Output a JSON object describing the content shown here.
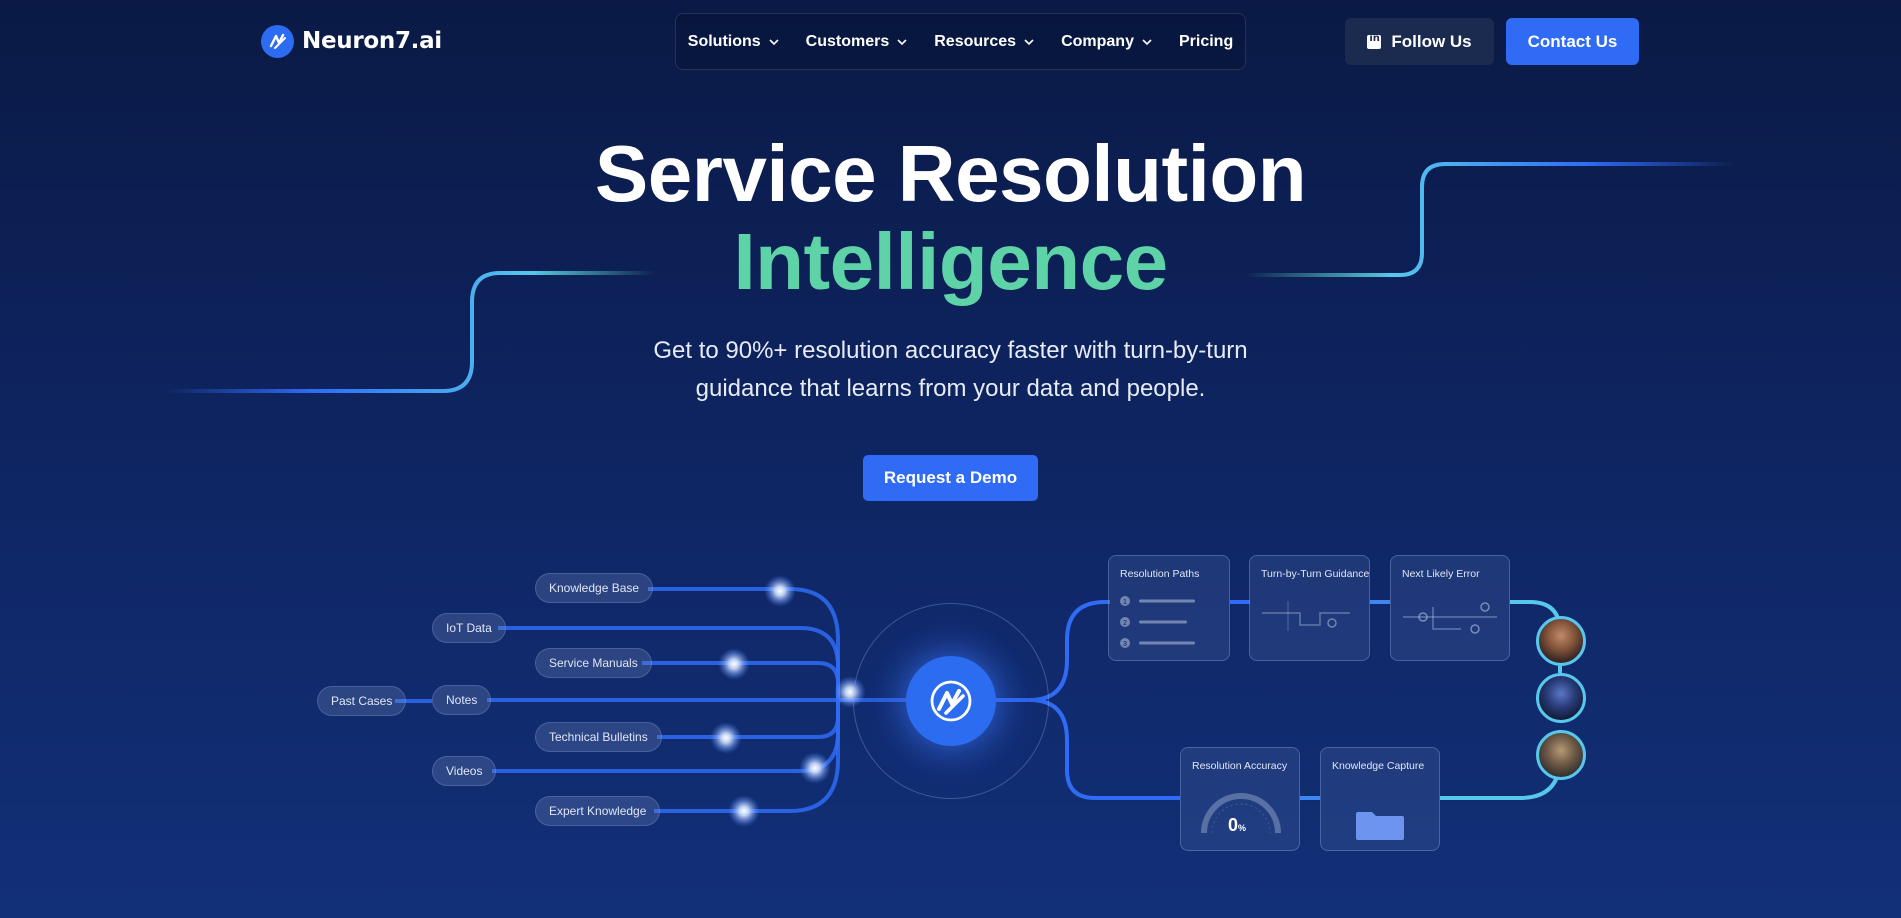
{
  "brand": {
    "name": "Neuron7.ai"
  },
  "nav": {
    "items": [
      {
        "label": "Solutions",
        "dropdown": true
      },
      {
        "label": "Customers",
        "dropdown": true
      },
      {
        "label": "Resources",
        "dropdown": true
      },
      {
        "label": "Company",
        "dropdown": true
      },
      {
        "label": "Pricing",
        "dropdown": false
      }
    ]
  },
  "header_actions": {
    "follow_label": "Follow Us",
    "contact_label": "Contact Us"
  },
  "hero": {
    "title_line1": "Service Resolution",
    "title_line2": "Intelligence",
    "subtitle": "Get to 90%+ resolution accuracy faster with turn-by-turn guidance that learns from your data and people.",
    "cta_label": "Request a Demo"
  },
  "diagram": {
    "sources": [
      "Knowledge Base",
      "IoT Data",
      "Service Manuals",
      "Past Cases",
      "Notes",
      "Technical Bulletins",
      "Videos",
      "Expert Knowledge"
    ],
    "cards": {
      "resolution_paths": "Resolution Paths",
      "path_steps": [
        "1",
        "2",
        "3"
      ],
      "turn_guidance": "Turn-by-Turn Guidance",
      "next_error": "Next Likely Error",
      "resolution_accuracy": "Resolution Accuracy",
      "knowledge_capture": "Knowledge Capture"
    },
    "accuracy_value": "0",
    "accuracy_unit": "%"
  },
  "colors": {
    "accent": "#2f6bf5",
    "highlight": "#5fd3a8",
    "background_top": "#0a1a45",
    "background_bottom": "#123078",
    "connector": "#2f6bf5",
    "connector_light": "#57c8ec"
  },
  "icons": [
    "logo-mark-icon",
    "chevron-down-icon",
    "linkedin-icon",
    "folder-icon",
    "avatar"
  ]
}
